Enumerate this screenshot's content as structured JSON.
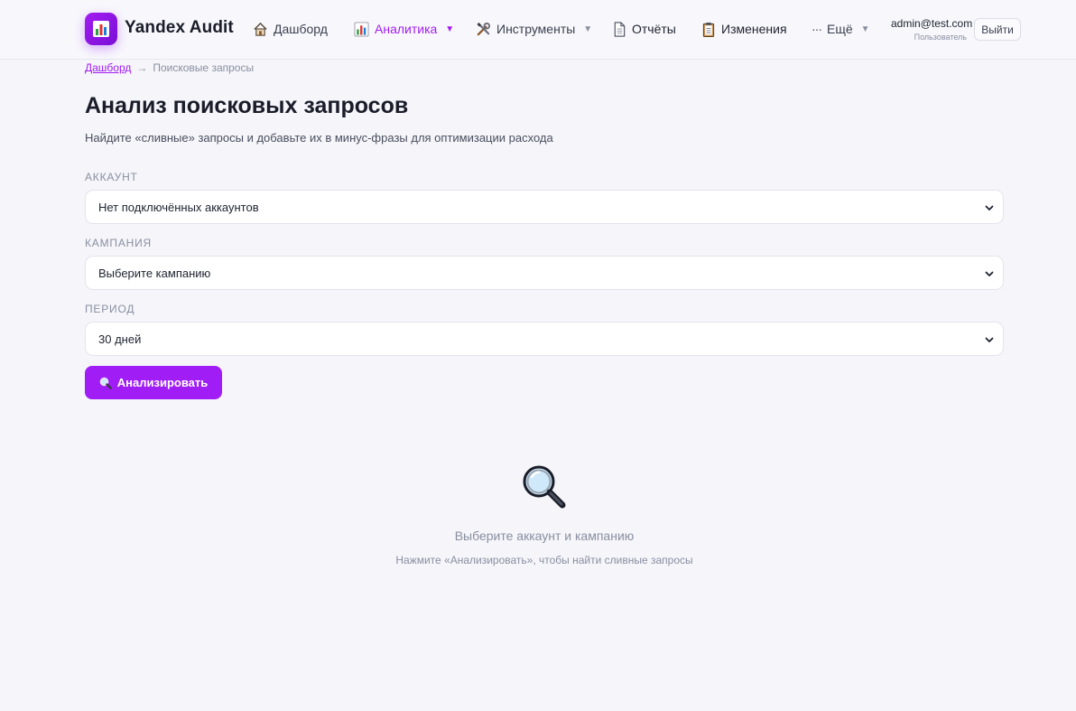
{
  "app": {
    "brand": "Yandex Audit"
  },
  "nav": {
    "items": [
      {
        "label": "Дашборд",
        "icon": "house-icon"
      },
      {
        "label": "Аналитика",
        "icon": "bar-chart-icon",
        "active": true,
        "dropdown": true
      },
      {
        "label": "Инструменты",
        "icon": "tools-icon",
        "dropdown": true
      },
      {
        "label": "Отчёты",
        "icon": "document-icon"
      },
      {
        "label": "Изменения",
        "icon": "clipboard-icon"
      },
      {
        "label": "Ещё",
        "icon": "ellipsis-icon",
        "dropdown": true
      }
    ]
  },
  "user": {
    "email": "admin@test.com",
    "role": "Пользователь",
    "logout_label": "Выйти"
  },
  "breadcrumb": {
    "home": "Дашборд",
    "separator": "→",
    "current": "Поисковые запросы"
  },
  "page": {
    "title": "Анализ поисковых запросов",
    "subtitle": "Найдите «сливные» запросы и добавьте их в минус-фразы для оптимизации расхода"
  },
  "form": {
    "account": {
      "label": "Аккаунт",
      "value": "Нет подключённых аккаунтов"
    },
    "campaign": {
      "label": "Кампания",
      "value": "Выберите кампанию"
    },
    "period": {
      "label": "Период",
      "value": "30 дней"
    },
    "analyze_label": "Анализировать"
  },
  "empty_state": {
    "title": "Выберите аккаунт и кампанию",
    "hint": "Нажмите «Анализировать», чтобы найти сливные запросы"
  },
  "colors": {
    "accent": "#a21cf0",
    "background": "#f5f5fa",
    "muted_text": "#8a8fa0"
  }
}
